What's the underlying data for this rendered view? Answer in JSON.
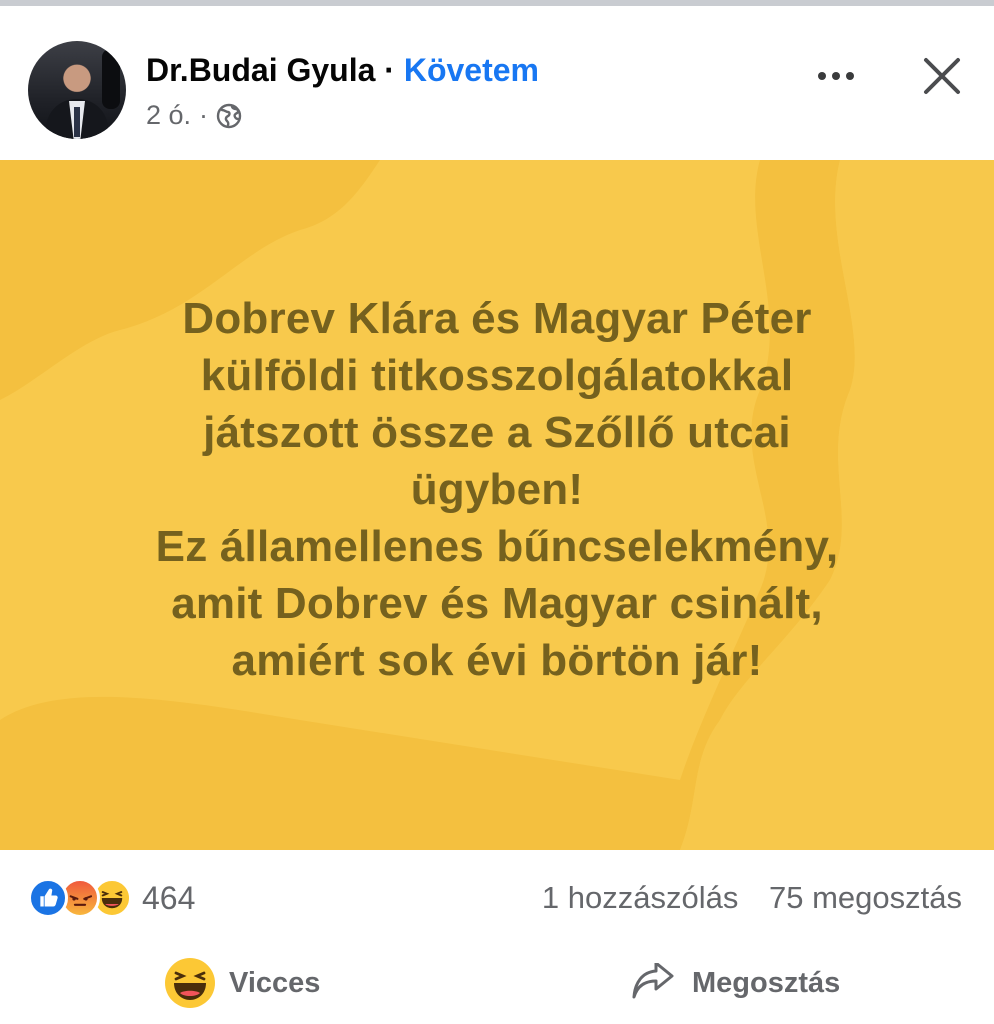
{
  "post": {
    "author_name": "Dr.Budai Gyula",
    "separator": "·",
    "follow_label": "Követem",
    "time": "2 ó.",
    "time_sep": "·",
    "icons": {
      "audience": "globe-icon",
      "more": "more-dots-icon",
      "close": "close-icon"
    },
    "body_text": "Dobrev Klára és Magyar Péter\nkülföldi titkosszolgálatokkal\njátszott össze a Szőllő utcai\nügyben!\nEz államellenes bűncselekmény,\namit Dobrev és Magyar csinált,\namiért sok évi börtön jár!",
    "background_color": "#f8c94c",
    "text_color": "#75611e"
  },
  "stats": {
    "reactions": [
      "like",
      "angry",
      "haha"
    ],
    "reaction_count": "464",
    "comments": "1 hozzászólás",
    "shares": "75 megosztás"
  },
  "actions": {
    "reaction_label": "Vicces",
    "share_label": "Megosztás"
  },
  "colors": {
    "accent": "#1877f2",
    "secondary_text": "#65676b"
  }
}
